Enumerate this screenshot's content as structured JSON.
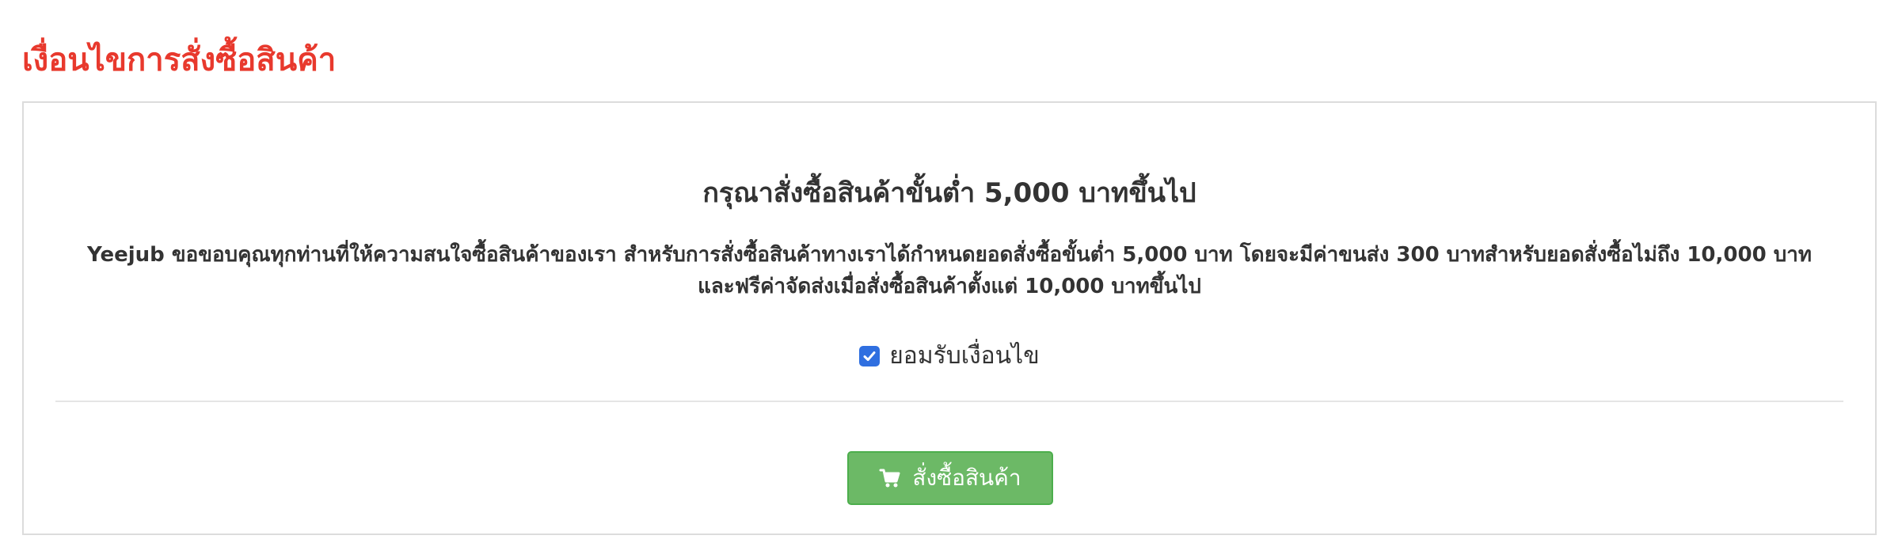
{
  "colors": {
    "title": "#e8392d",
    "text": "#333333",
    "panel_border": "#dcdcdc",
    "divider": "#e5e5e5",
    "checkbox": "#2f6fe0",
    "button_bg": "#6cb966",
    "button_border": "#4cae4c",
    "button_text": "#ffffff"
  },
  "page": {
    "title": "เงื่อนไขการสั่งซื้อสินค้า"
  },
  "panel": {
    "heading": "กรุณาสั่งซื้อสินค้าขั้นต่ำ 5,000 บาทขึ้นไป",
    "description": "Yeejub ขอขอบคุณทุกท่านที่ให้ความสนใจซื้อสินค้าของเรา สำหรับการสั่งซื้อสินค้าทางเราได้กำหนดยอดสั่งซื้อขั้นต่ำ 5,000 บาท โดยจะมีค่าขนส่ง 300 บาทสำหรับยอดสั่งซื้อไม่ถึง 10,000 บาท\nและฟรีค่าจัดส่งเมื่อสั่งซื้อสินค้าตั้งแต่ 10,000 บาทขึ้นไป",
    "consent": {
      "checked": true,
      "label": "ยอมรับเงื่อนไข",
      "icon": "checkmark-icon"
    },
    "order_button": {
      "label": "สั่งซื้อสินค้า",
      "icon": "cart-icon"
    }
  }
}
